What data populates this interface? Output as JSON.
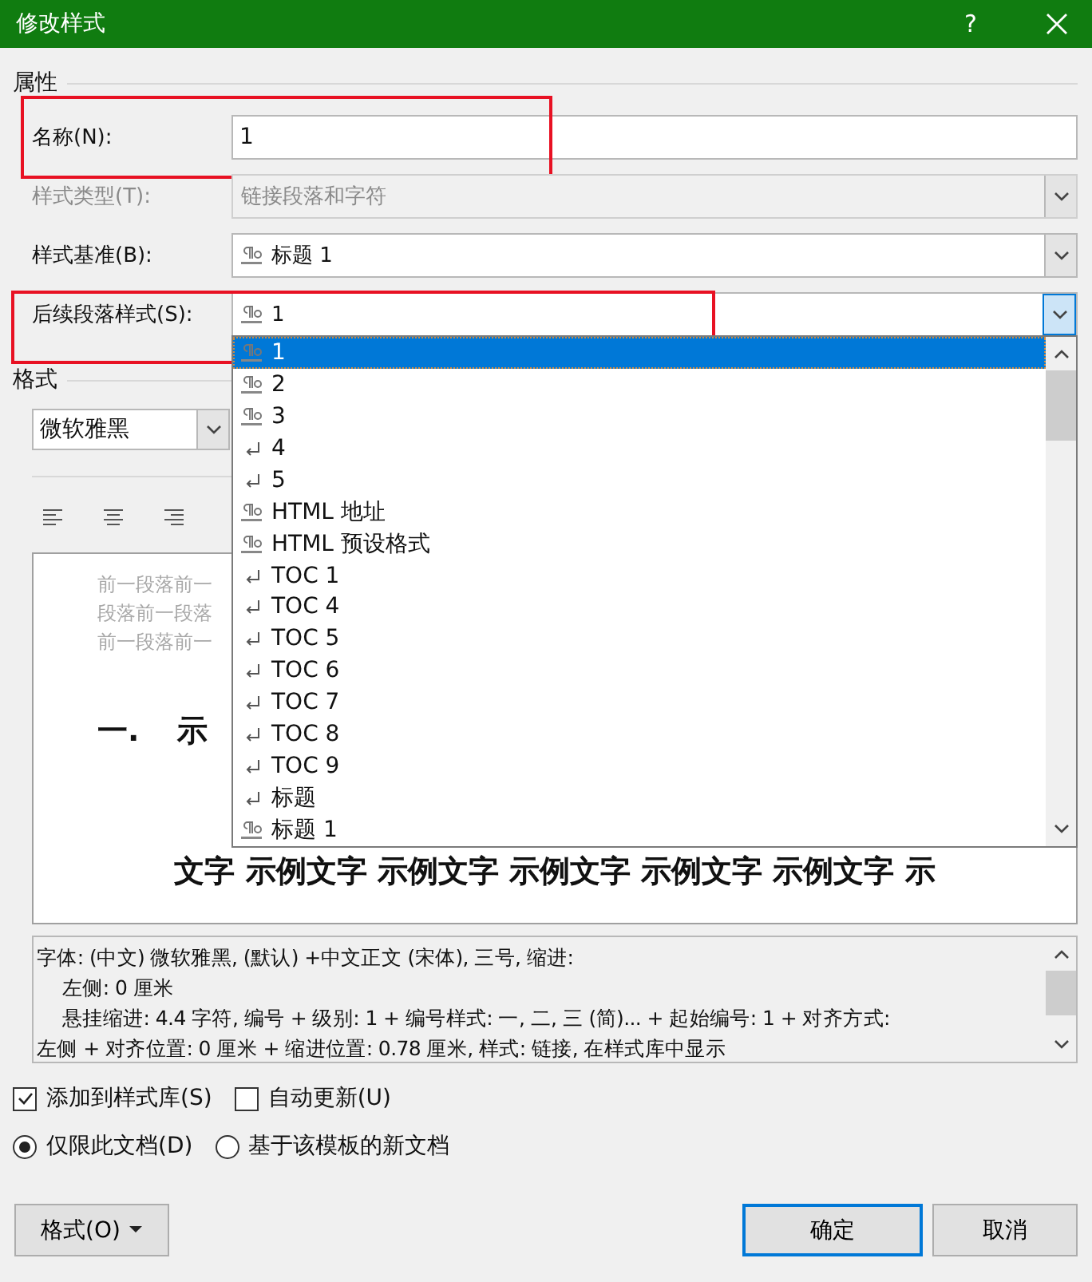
{
  "window": {
    "title": "修改样式",
    "help": "?"
  },
  "properties": {
    "heading": "属性",
    "fields": [
      {
        "kind": "text",
        "label": "名称(N):",
        "value": "1",
        "disabled": false,
        "highlighted": true
      },
      {
        "kind": "combo",
        "label": "样式类型(T):",
        "value": "链接段落和字符",
        "disabled": true,
        "highlighted": false,
        "open": false
      },
      {
        "kind": "linked_combo",
        "label": "样式基准(B):",
        "value": "标题 1",
        "disabled": false,
        "highlighted": false,
        "open": false
      },
      {
        "kind": "linked_combo",
        "label": "后续段落样式(S):",
        "value": "1",
        "disabled": false,
        "highlighted": true,
        "open": true
      }
    ]
  },
  "dropdown": {
    "items": [
      {
        "label": "1",
        "kind": "linked",
        "selected": true
      },
      {
        "label": "2",
        "kind": "linked",
        "selected": false
      },
      {
        "label": "3",
        "kind": "linked",
        "selected": false
      },
      {
        "label": "4",
        "kind": "paragraph",
        "selected": false
      },
      {
        "label": "5",
        "kind": "paragraph",
        "selected": false
      },
      {
        "label": "HTML 地址",
        "kind": "linked",
        "selected": false
      },
      {
        "label": "HTML 预设格式",
        "kind": "linked",
        "selected": false
      },
      {
        "label": "TOC 1",
        "kind": "paragraph",
        "selected": false
      },
      {
        "label": "TOC 4",
        "kind": "paragraph",
        "selected": false
      },
      {
        "label": "TOC 5",
        "kind": "paragraph",
        "selected": false
      },
      {
        "label": "TOC 6",
        "kind": "paragraph",
        "selected": false
      },
      {
        "label": "TOC 7",
        "kind": "paragraph",
        "selected": false
      },
      {
        "label": "TOC 8",
        "kind": "paragraph",
        "selected": false
      },
      {
        "label": "TOC 9",
        "kind": "paragraph",
        "selected": false
      },
      {
        "label": "标题",
        "kind": "paragraph",
        "selected": false
      },
      {
        "label": "标题 1",
        "kind": "linked",
        "selected": false
      }
    ]
  },
  "format": {
    "heading": "格式",
    "font": "微软雅黑",
    "alignments": [
      {
        "kind": "left"
      },
      {
        "kind": "center"
      },
      {
        "kind": "right"
      }
    ],
    "preview": {
      "previous_lines": [
        "前一段落前一",
        "段落前一段落",
        "前一段落前一"
      ],
      "heading_number": "一.",
      "heading_text": "示",
      "sample_line": "文字 示例文字 示例文字 示例文字 示例文字 示例文字 示"
    }
  },
  "description": [
    {
      "text": "字体: (中文) 微软雅黑, (默认) +中文正文 (宋体), 三号, 缩进:",
      "indented": false
    },
    {
      "text": "左侧:  0 厘米",
      "indented": true
    },
    {
      "text": "悬挂缩进: 4.4 字符, 编号 + 级别: 1 + 编号样式: 一, 二, 三 (简)... + 起始编号: 1 + 对齐方式:",
      "indented": true
    },
    {
      "text": "左侧 + 对齐位置:  0 厘米 + 缩进位置:  0.78 厘米, 样式: 链接, 在样式库中显示",
      "indented": false
    }
  ],
  "checkboxes": [
    {
      "label": "添加到样式库(S)",
      "checked": true
    },
    {
      "label": "自动更新(U)",
      "checked": false
    }
  ],
  "radios": [
    {
      "label": "仅限此文档(D)",
      "selected": true
    },
    {
      "label": "基于该模板的新文档",
      "selected": false
    }
  ],
  "format_button": {
    "label": "格式(O)",
    "menu": true
  },
  "buttons": [
    {
      "label": "确定",
      "default": true
    },
    {
      "label": "取消",
      "default": false
    }
  ]
}
